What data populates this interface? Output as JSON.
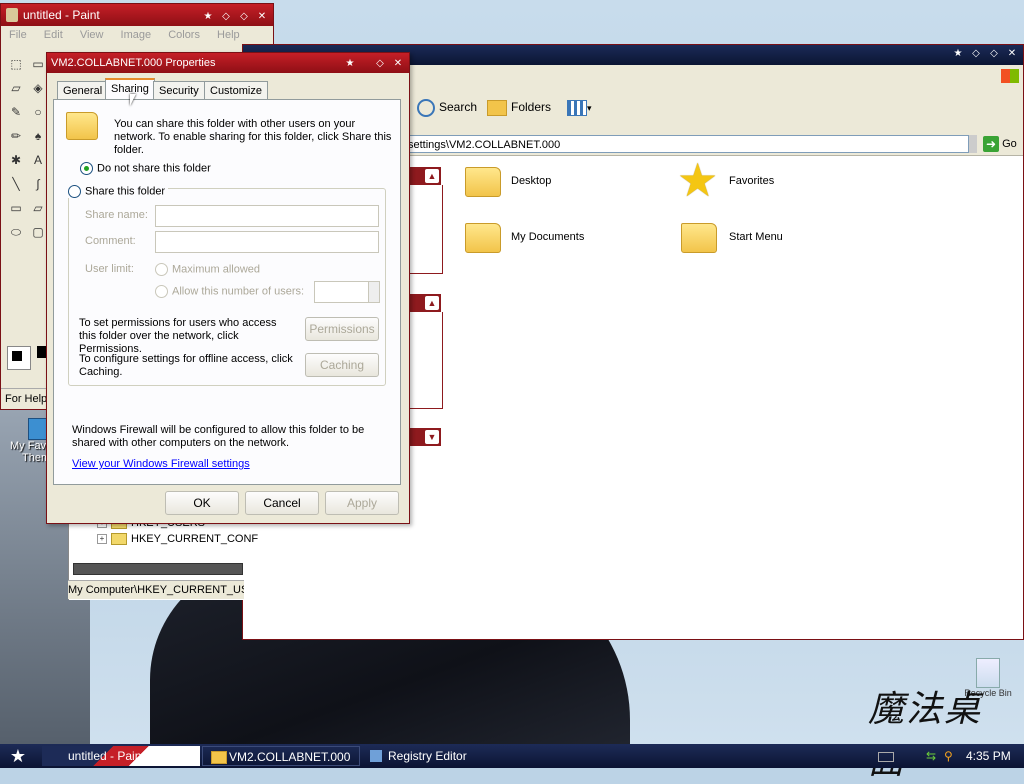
{
  "paint": {
    "title": "untitled - Paint",
    "menu": [
      "File",
      "Edit",
      "View",
      "Image",
      "Colors",
      "Help"
    ],
    "status": "For Help,"
  },
  "desktop": {
    "icon_label_1": "My Favo",
    "icon_label_2": "Them",
    "recycle_label": "Recycle Bin",
    "brand_text": "魔法桌面"
  },
  "explorer": {
    "title": "",
    "toolbar": {
      "search": "Search",
      "folders": "Folders"
    },
    "address": "settings\\VM2.COLLABNET.000",
    "go": "Go",
    "items": [
      {
        "label": "Desktop",
        "icon": "folder-icon"
      },
      {
        "label": "Favorites",
        "icon": "star-icon"
      },
      {
        "label": "My Documents",
        "icon": "folder-icon"
      },
      {
        "label": "Start Menu",
        "icon": "folder-icon"
      }
    ]
  },
  "regedit": {
    "rows": [
      "HKEY_USERS",
      "HKEY_CURRENT_CONF"
    ],
    "status": "My Computer\\HKEY_CURRENT_USE"
  },
  "dialog": {
    "title": "VM2.COLLABNET.000 Properties",
    "tabs": [
      "General",
      "Sharing",
      "Security",
      "Customize"
    ],
    "active_tab": "Sharing",
    "intro": "You can share this folder with other users on your network.  To enable sharing for this folder, click Share this folder.",
    "radio_no_share": "Do not share this folder",
    "radio_share": "Share this folder",
    "share_name_label": "Share name:",
    "comment_label": "Comment:",
    "user_limit_label": "User limit:",
    "max_allowed": "Maximum allowed",
    "allow_number": "Allow this number of users:",
    "permissions_text": "To set permissions for users who access this folder over the network, click Permissions.",
    "permissions_button": "Permissions",
    "caching_text": "To configure settings for offline access, click Caching.",
    "caching_button": "Caching",
    "firewall_text": "Windows Firewall will be configured to allow this folder to be shared with other computers on the network.",
    "firewall_link": "View your Windows Firewall settings",
    "ok": "OK",
    "cancel": "Cancel",
    "apply": "Apply"
  },
  "taskbar": {
    "tasks": [
      "untitled - Paint",
      "VM2.COLLABNET.000",
      "Registry Editor"
    ],
    "clock": "4:35 PM"
  }
}
